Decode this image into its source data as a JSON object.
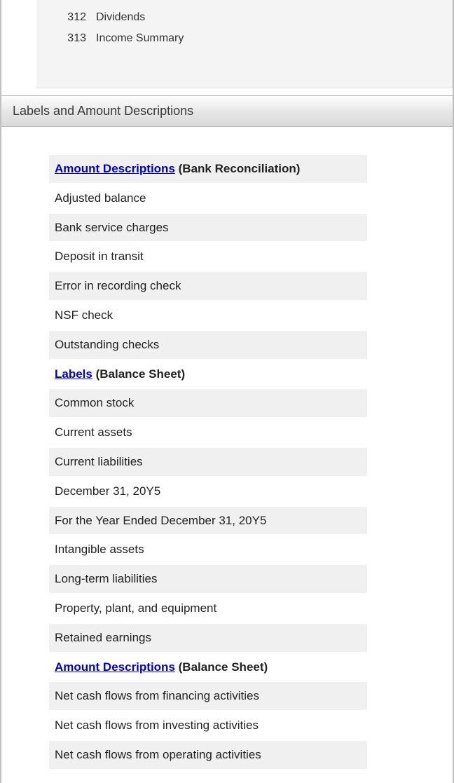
{
  "accounts": [
    {
      "num": "312",
      "name": "Dividends"
    },
    {
      "num": "313",
      "name": "Income Summary"
    }
  ],
  "section_title": "Labels and Amount Descriptions",
  "groups": [
    {
      "link": "Amount Descriptions",
      "suffix": " (Bank Reconciliation)",
      "items": [
        "Adjusted balance",
        "Bank service charges",
        "Deposit in transit",
        "Error in recording check",
        "NSF check",
        "Outstanding checks"
      ]
    },
    {
      "link": "Labels",
      "suffix": " (Balance Sheet)",
      "items": [
        "Common stock",
        "Current assets",
        "Current liabilities",
        "December 31, 20Y5",
        "For the Year Ended December 31, 20Y5",
        "Intangible assets",
        "Long-term liabilities",
        "Property, plant, and equipment",
        "Retained earnings"
      ]
    },
    {
      "link": "Amount  Descriptions",
      "suffix": " (Balance Sheet)",
      "items": [
        "Net cash flows from financing activities",
        "Net cash flows from investing activities",
        "Net cash flows from operating activities"
      ]
    }
  ]
}
